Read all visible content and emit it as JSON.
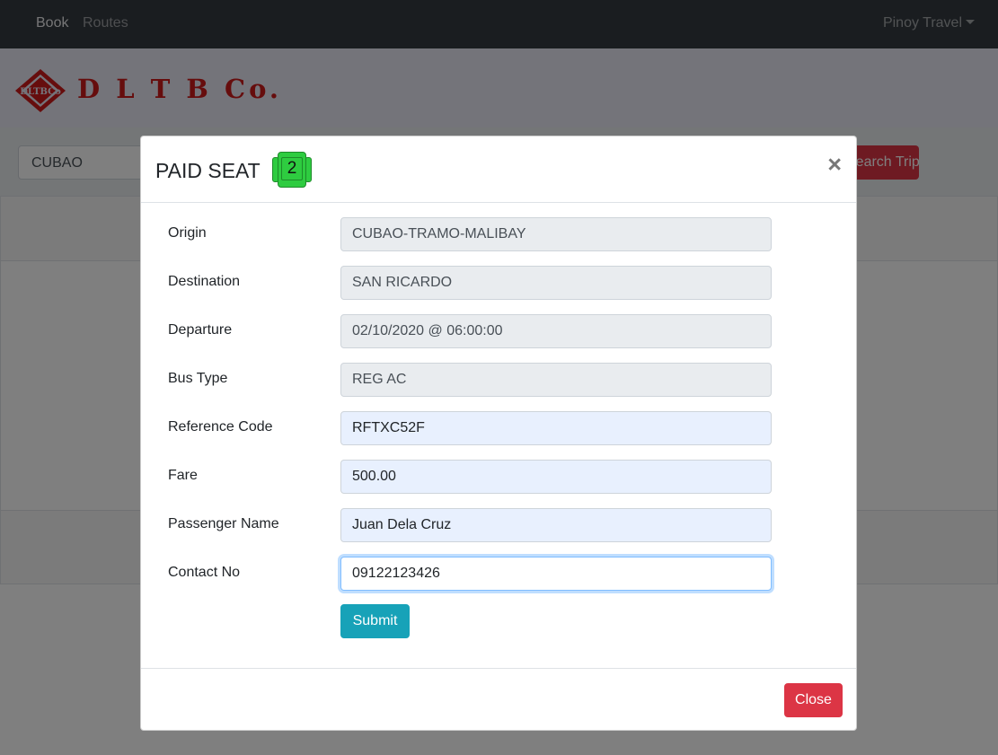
{
  "nav": {
    "book": "Book",
    "routes": "Routes",
    "user": "Pinoy Travel"
  },
  "brand": {
    "logo_text": "D L T B Co.",
    "logo_mark_text": "DLTBCo"
  },
  "search": {
    "origin_value": "CUBAO",
    "search_button": "Search Trip"
  },
  "modal": {
    "title": "PAID SEAT",
    "seat_number": "2",
    "close_symbol": "×",
    "fields": {
      "origin": {
        "label": "Origin",
        "value": "CUBAO-TRAMO-MALIBAY"
      },
      "destination": {
        "label": "Destination",
        "value": "SAN RICARDO"
      },
      "departure": {
        "label": "Departure",
        "value": "02/10/2020 @ 06:00:00"
      },
      "bus_type": {
        "label": "Bus Type",
        "value": "REG AC"
      },
      "reference_code": {
        "label": "Reference Code",
        "value": "RFTXC52F"
      },
      "fare": {
        "label": "Fare",
        "value": "500.00"
      },
      "passenger_name": {
        "label": "Passenger Name",
        "value": "Juan Dela Cruz"
      },
      "contact_no": {
        "label": "Contact No",
        "value": "09122123426"
      }
    },
    "submit_label": "Submit",
    "close_label": "Close"
  },
  "colors": {
    "navbar": "#343a40",
    "brand_red": "#cc1b1b",
    "danger": "#dc3545",
    "info": "#17a2b8",
    "seat_green": "#2ecc40"
  },
  "icons": {
    "seat": "seat-icon",
    "close": "close-icon",
    "caret": "caret-down-icon"
  }
}
